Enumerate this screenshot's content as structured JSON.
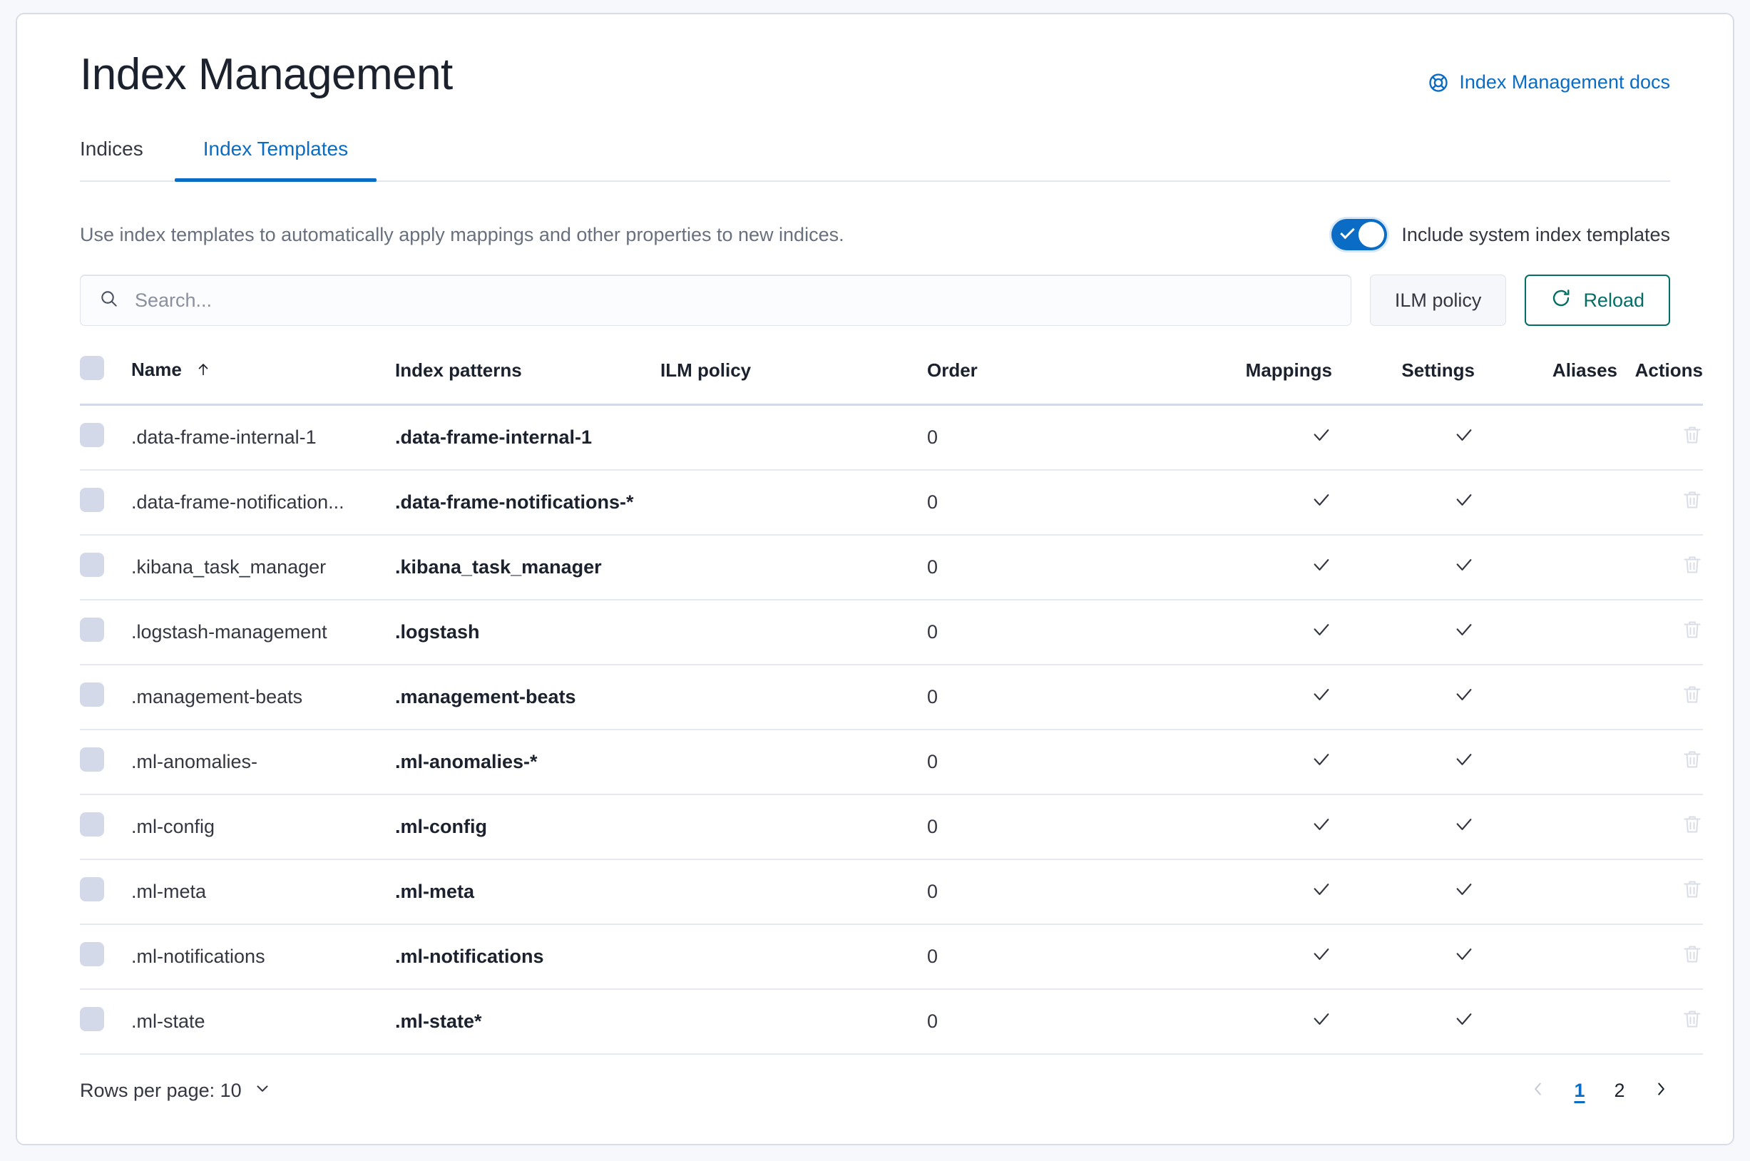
{
  "header": {
    "title": "Index Management",
    "docs_link": "Index Management docs",
    "docs_icon": "help-ring-icon"
  },
  "tabs": [
    {
      "label": "Indices",
      "active": false
    },
    {
      "label": "Index Templates",
      "active": true
    }
  ],
  "description": "Use index templates to automatically apply mappings and other properties to new indices.",
  "system_toggle": {
    "label": "Include system index templates",
    "on": true,
    "accent": "#0a6cc4"
  },
  "search": {
    "placeholder": "Search...",
    "value": "",
    "icon": "search-icon"
  },
  "buttons": {
    "ilm_policy": "ILM policy",
    "reload": "Reload",
    "reload_icon": "refresh-icon",
    "reload_accent": "#046e66"
  },
  "table": {
    "columns": [
      "Name",
      "Index patterns",
      "ILM policy",
      "Order",
      "Mappings",
      "Settings",
      "Aliases",
      "Actions"
    ],
    "sort": {
      "column": "Name",
      "direction": "asc",
      "icon": "arrow-up-icon"
    },
    "rows": [
      {
        "name": ".data-frame-internal-1",
        "pattern": ".data-frame-internal-1",
        "ilm": "",
        "order": "0",
        "mappings": "✓",
        "settings": "✓",
        "aliases": ""
      },
      {
        "name": ".data-frame-notification...",
        "pattern": ".data-frame-notifications-*",
        "ilm": "",
        "order": "0",
        "mappings": "✓",
        "settings": "✓",
        "aliases": ""
      },
      {
        "name": ".kibana_task_manager",
        "pattern": ".kibana_task_manager",
        "ilm": "",
        "order": "0",
        "mappings": "✓",
        "settings": "✓",
        "aliases": ""
      },
      {
        "name": ".logstash-management",
        "pattern": ".logstash",
        "ilm": "",
        "order": "0",
        "mappings": "✓",
        "settings": "✓",
        "aliases": ""
      },
      {
        "name": ".management-beats",
        "pattern": ".management-beats",
        "ilm": "",
        "order": "0",
        "mappings": "✓",
        "settings": "✓",
        "aliases": ""
      },
      {
        "name": ".ml-anomalies-",
        "pattern": ".ml-anomalies-*",
        "ilm": "",
        "order": "0",
        "mappings": "✓",
        "settings": "✓",
        "aliases": ""
      },
      {
        "name": ".ml-config",
        "pattern": ".ml-config",
        "ilm": "",
        "order": "0",
        "mappings": "✓",
        "settings": "✓",
        "aliases": ""
      },
      {
        "name": ".ml-meta",
        "pattern": ".ml-meta",
        "ilm": "",
        "order": "0",
        "mappings": "✓",
        "settings": "✓",
        "aliases": ""
      },
      {
        "name": ".ml-notifications",
        "pattern": ".ml-notifications",
        "ilm": "",
        "order": "0",
        "mappings": "✓",
        "settings": "✓",
        "aliases": ""
      },
      {
        "name": ".ml-state",
        "pattern": ".ml-state*",
        "ilm": "",
        "order": "0",
        "mappings": "✓",
        "settings": "✓",
        "aliases": ""
      }
    ],
    "row_action_icon": "trash-icon"
  },
  "footer": {
    "rows_per_page_label": "Rows per page: 10",
    "rows_per_page_icon": "chevron-down-icon",
    "prev_icon": "chevron-left-icon",
    "next_icon": "chevron-right-icon",
    "pages": [
      "1",
      "2"
    ],
    "active_page": "1"
  }
}
